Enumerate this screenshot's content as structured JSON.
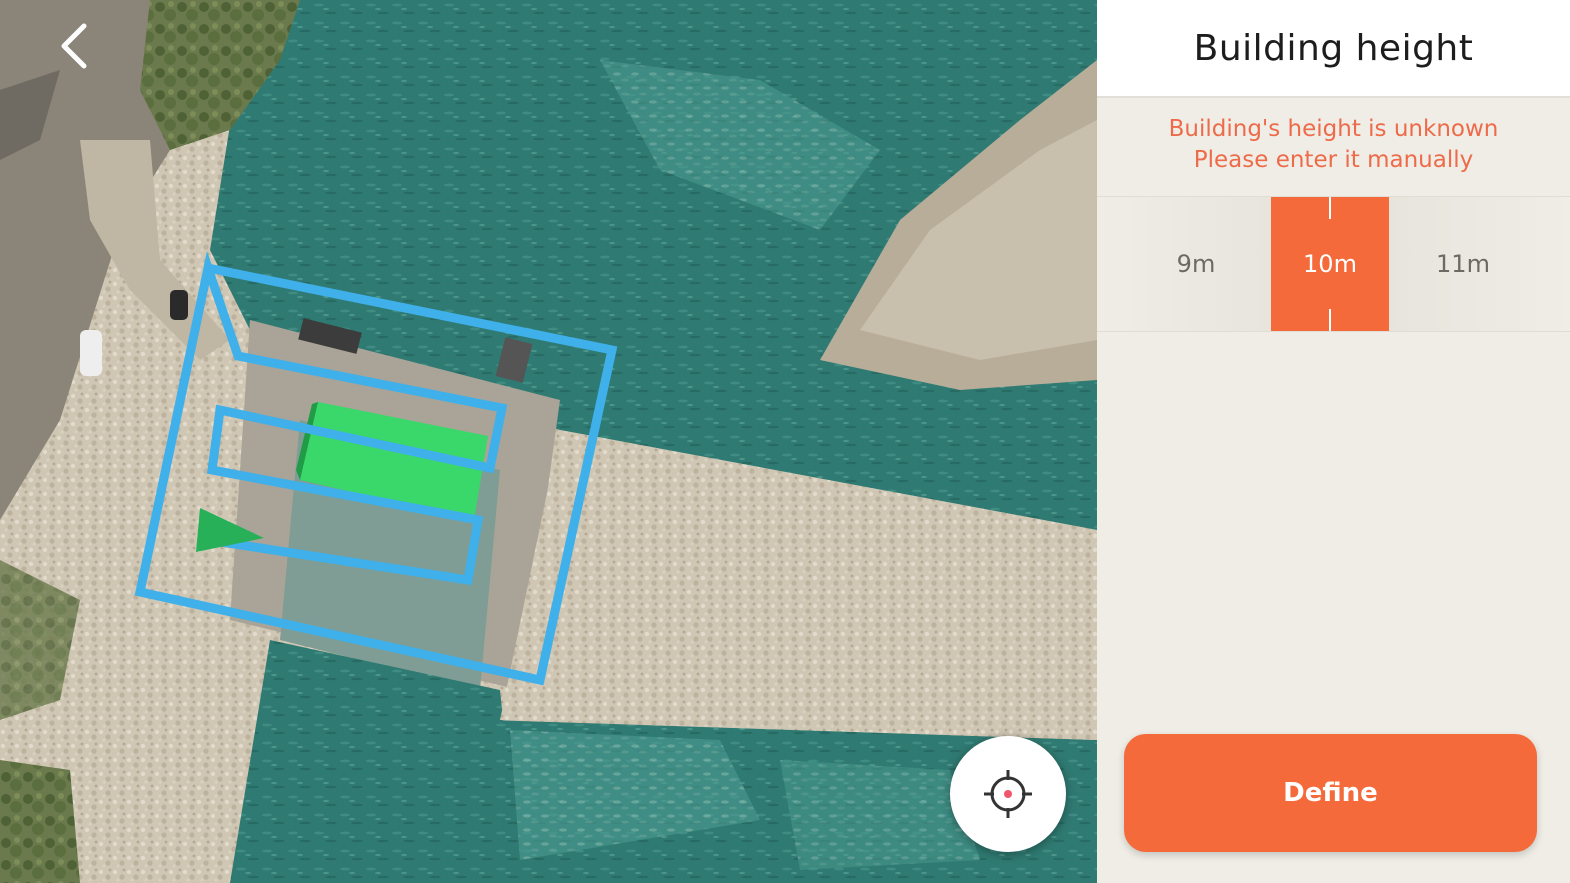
{
  "panel": {
    "title": "Building height",
    "warning_line1": "Building's height is unknown",
    "warning_line2": "Please enter it manually",
    "height_options": [
      "9m",
      "10m",
      "11m"
    ],
    "selected_height": "10m",
    "define_label": "Define"
  },
  "map": {
    "back_icon": "chevron-left-icon",
    "locate_icon": "crosshair-icon",
    "flight_path_color": "#3fb0ea",
    "building_color": "#3ad86a"
  },
  "colors": {
    "accent": "#f46a3a",
    "warning": "#ee6b4a",
    "panel_bg": "#efede6"
  }
}
